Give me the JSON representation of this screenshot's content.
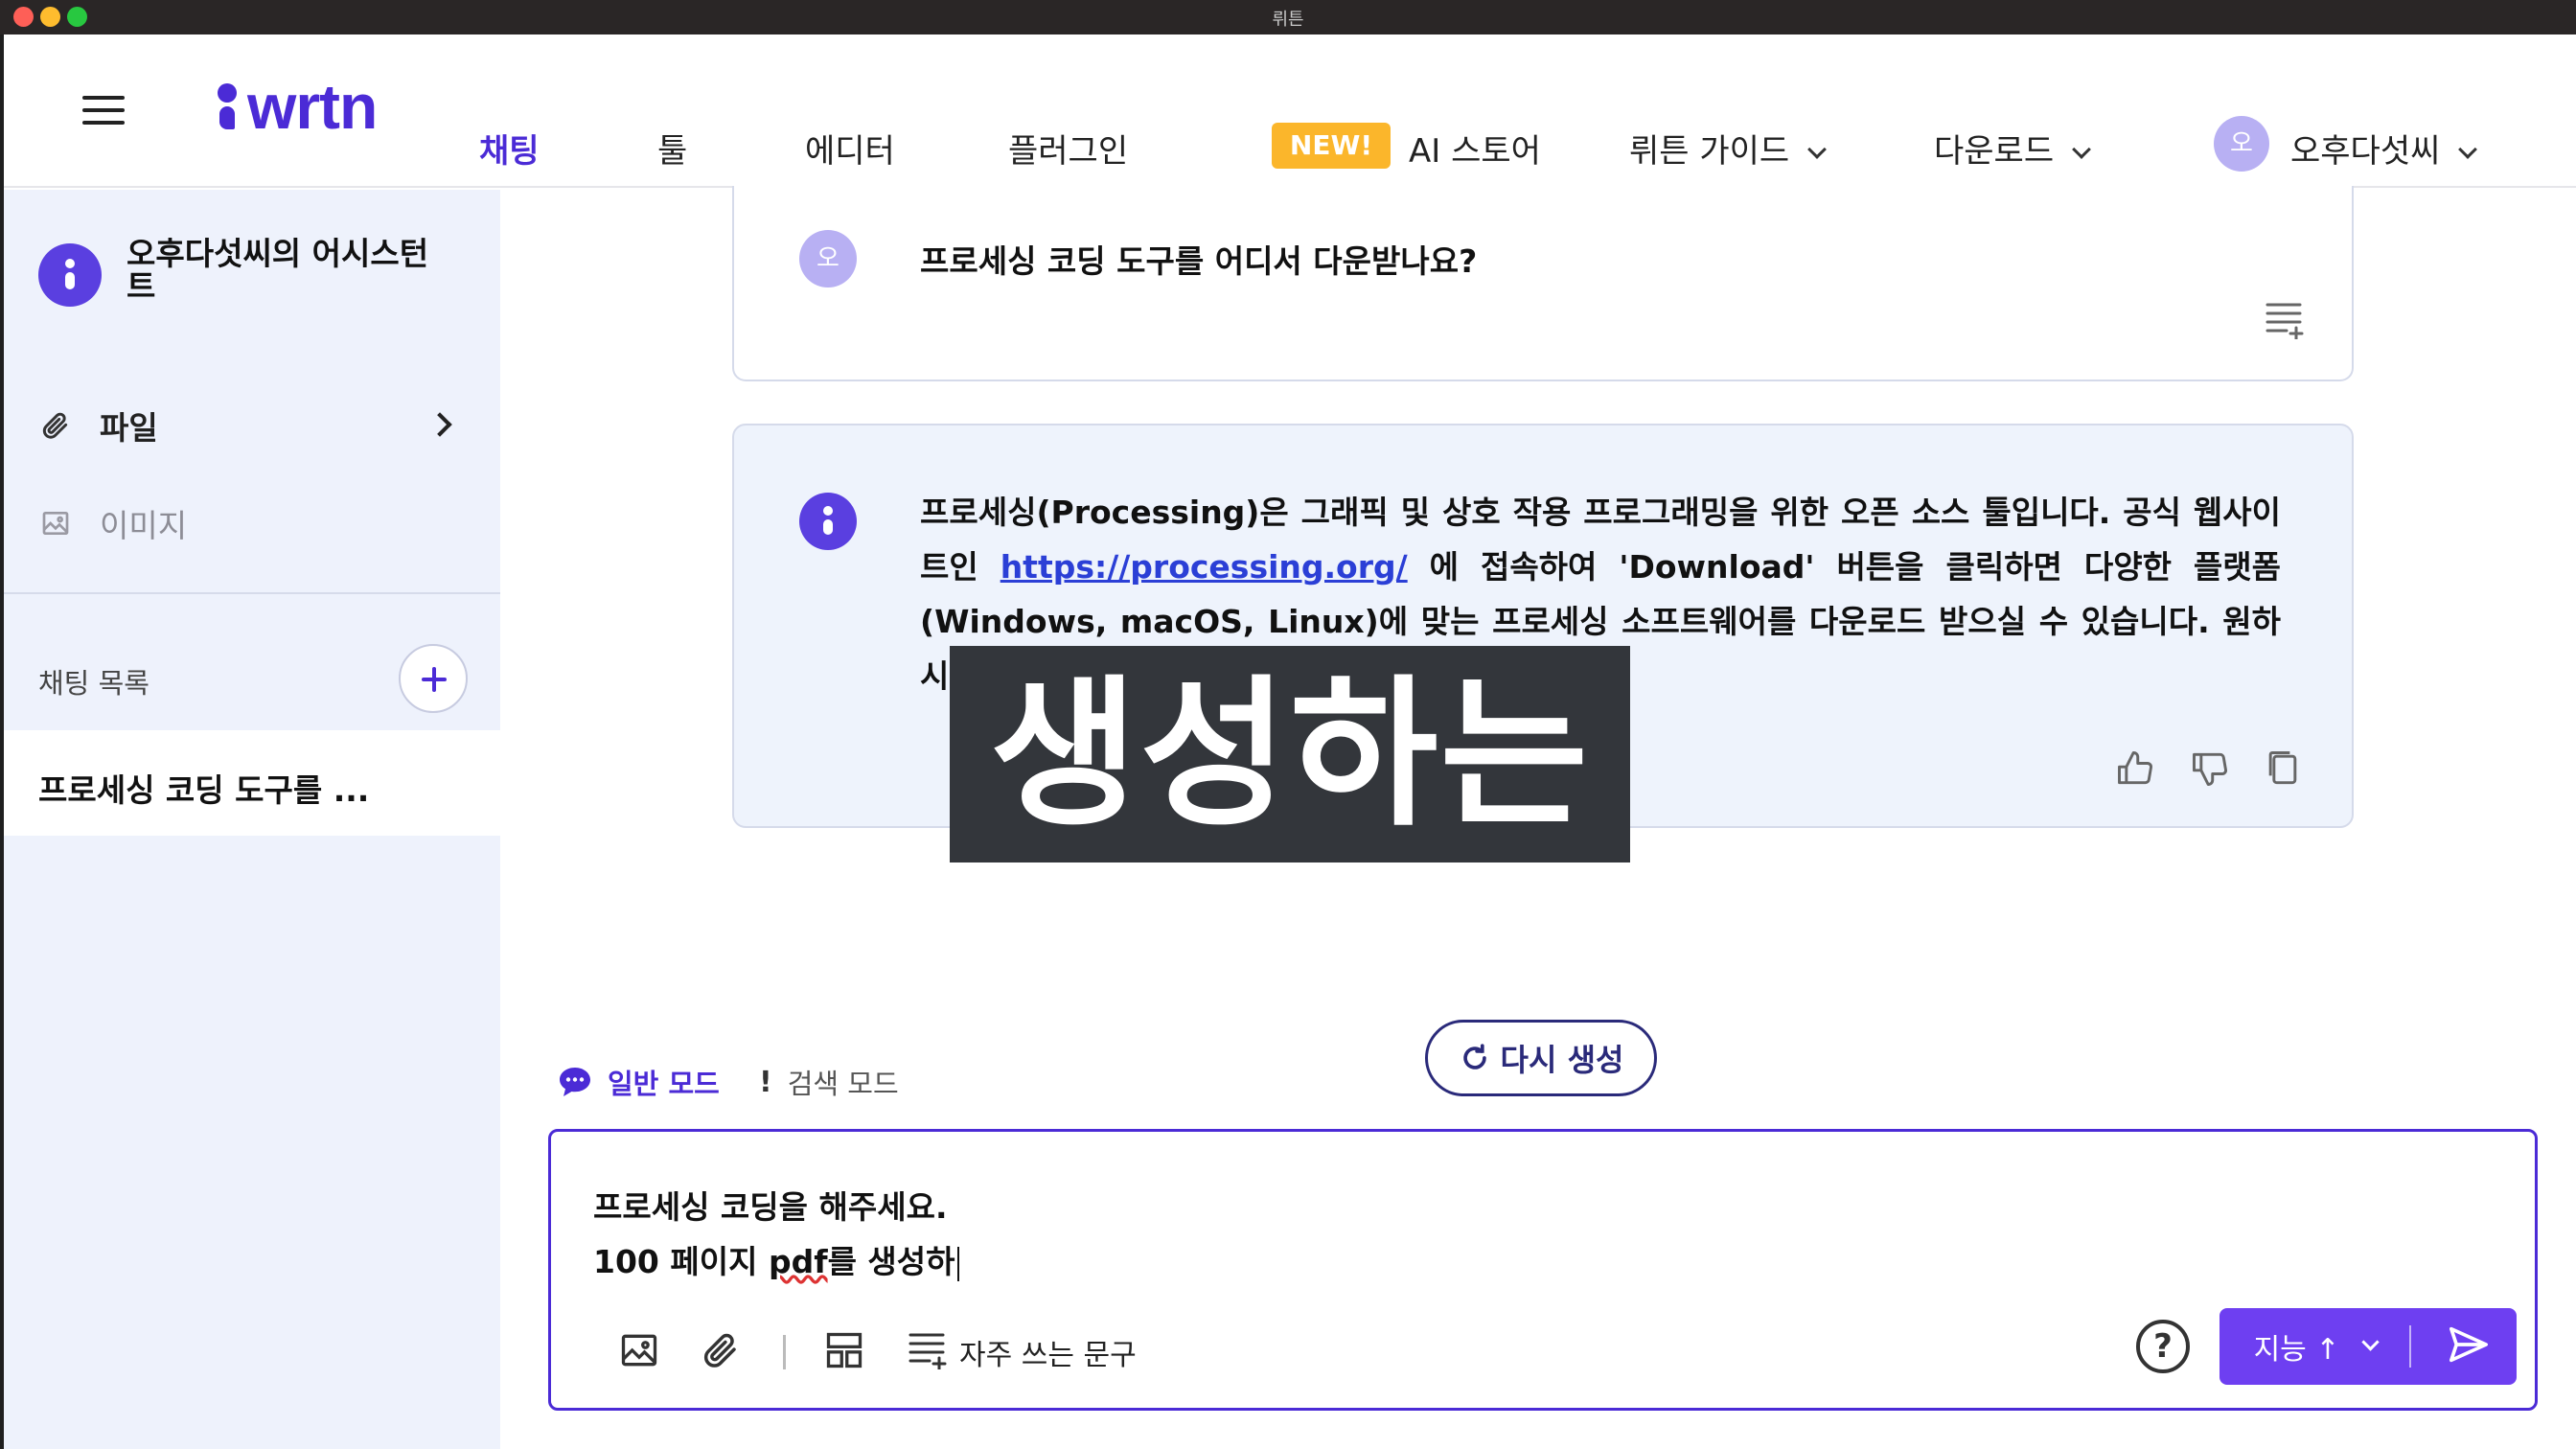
{
  "window": {
    "title": "뤼튼"
  },
  "nav": {
    "logo": "wrtn",
    "items": [
      {
        "label": "채팅",
        "active": true
      },
      {
        "label": "툴"
      },
      {
        "label": "에디터"
      },
      {
        "label": "플러그인"
      }
    ],
    "new_badge": "NEW!",
    "store": "AI 스토어",
    "guide": "뤼튼 가이드",
    "download": "다운로드",
    "user_avatar_initial": "오",
    "user_name": "오후다섯씨"
  },
  "sidebar": {
    "assistant_name": "오후다섯씨의 어시스턴트",
    "files_label": "파일",
    "images_label": "이미지",
    "chat_list_label": "채팅 목록",
    "chats": [
      {
        "label": "프로세싱 코딩 도구를 ..."
      }
    ]
  },
  "messages": {
    "user": {
      "avatar_initial": "오",
      "text": "프로세싱 코딩 도구를 어디서 다운받나요?"
    },
    "bot": {
      "text_before_link": "프로세싱(Processing)은 그래픽 및 상호 작용 프로그래밍을 위한 오픈 소스 툴입니다. 공식 웹사이트인 ",
      "link": "https://processing.org/",
      "text_after_link": " 에 접속하여 'Download' 버튼을 클릭하면 다양한 플랫폼(Windows, macOS, Linux)에 맞는 프로세싱 소프트웨어를 다운로드 받으실 수 있습니다. 원하시는 버전과 플랫폼을 선택하여 설치하시면 됩니다."
    }
  },
  "overlay_caption": "생성하는",
  "regenerate_label": "다시 생성",
  "modes": {
    "general": "일반 모드",
    "search": "검색 모드"
  },
  "composer": {
    "line1": "프로세싱 코딩을 해주세요.",
    "line2_prefix": "100 페이지 ",
    "line2_misspelled": "pdf",
    "line2_suffix": "를 생성하",
    "phrases_label": "자주 쓰는 문구",
    "help_symbol": "?",
    "model_label": "지능 ↑"
  },
  "colors": {
    "accent": "#4b2bd6",
    "send_button": "#6e3ff1",
    "new_badge": "#fbb62b",
    "sidebar_bg": "#eef2fc"
  }
}
